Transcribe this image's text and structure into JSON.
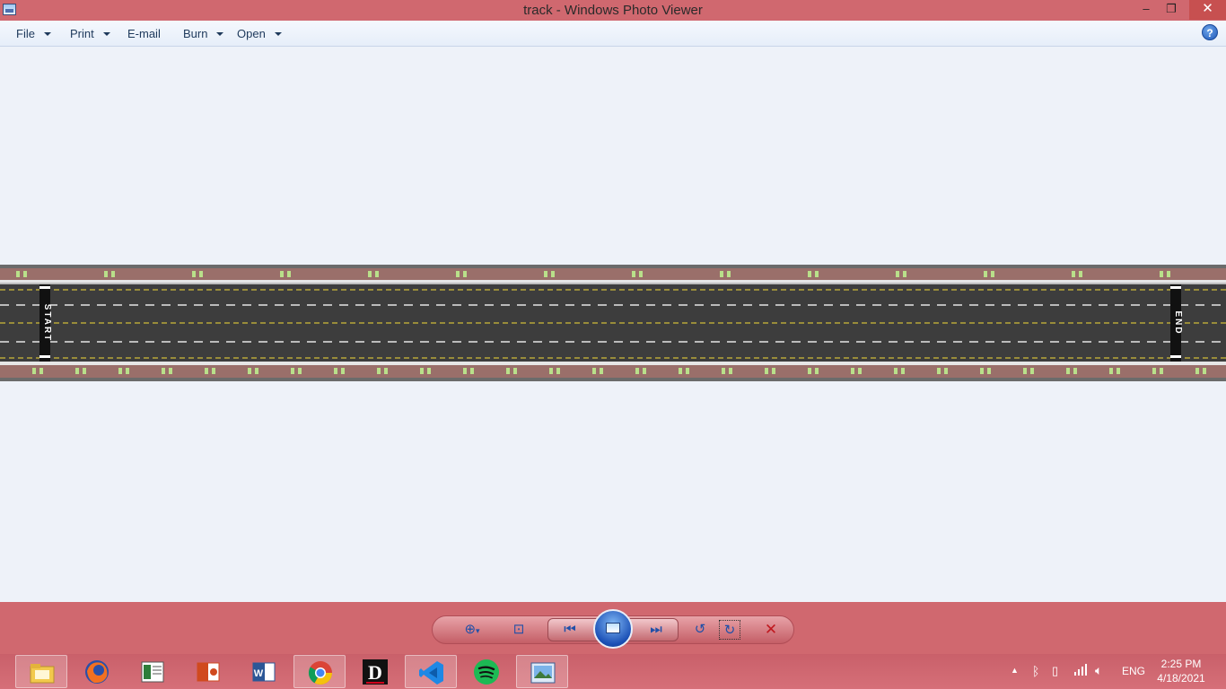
{
  "window": {
    "title": "track - Windows Photo Viewer",
    "minimize_glyph": "–",
    "maximize_glyph": "❐",
    "close_glyph": "✕"
  },
  "menu": {
    "items": [
      {
        "label": "File",
        "has_dropdown": true
      },
      {
        "label": "Print",
        "has_dropdown": true
      },
      {
        "label": "E-mail",
        "has_dropdown": false
      },
      {
        "label": "Burn",
        "has_dropdown": true
      },
      {
        "label": "Open",
        "has_dropdown": true
      }
    ],
    "help_glyph": "?"
  },
  "image": {
    "start_label": "START",
    "end_label": "END"
  },
  "controls": {
    "zoom_icon": "zoom-icon",
    "actual_size_icon": "actual-size-icon",
    "previous_icon": "previous-icon",
    "slideshow_icon": "slideshow-icon",
    "next_icon": "next-icon",
    "rotate_ccw_icon": "rotate-counterclockwise-icon",
    "rotate_cw_icon": "rotate-clockwise-icon",
    "delete_icon": "delete-icon"
  },
  "taskbar": {
    "apps": [
      {
        "name": "file-explorer",
        "active": true
      },
      {
        "name": "firefox",
        "active": false
      },
      {
        "name": "reader",
        "active": false
      },
      {
        "name": "powerpoint",
        "active": false
      },
      {
        "name": "word",
        "active": false
      },
      {
        "name": "chrome",
        "active": true
      },
      {
        "name": "d-app",
        "active": false
      },
      {
        "name": "vscode",
        "active": true
      },
      {
        "name": "spotify",
        "active": false
      },
      {
        "name": "photo-viewer",
        "active": true
      }
    ],
    "language": "ENG",
    "time": "2:25 PM",
    "date": "4/18/2021"
  }
}
